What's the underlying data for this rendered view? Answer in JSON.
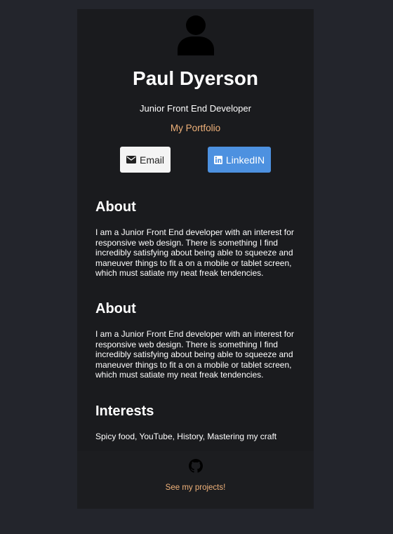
{
  "profile": {
    "name": "Paul Dyerson",
    "role": "Junior Front End Developer",
    "portfolio_label": "My Portfolio"
  },
  "buttons": {
    "email_label": "Email",
    "linkedin_label": "LinkedIN"
  },
  "sections": [
    {
      "title": "About",
      "text": "I am a Junior Front End developer with an interest for responsive web design. There is something I find incredibly satisfying about being able to squeeze and maneuver things to fit a on a mobile or tablet screen, which must satiate my neat freak tendencies."
    },
    {
      "title": "About",
      "text": "I am a Junior Front End developer with an interest for responsive web design. There is something I find incredibly satisfying about being able to squeeze and maneuver things to fit a on a mobile or tablet screen, which must satiate my neat freak tendencies."
    },
    {
      "title": "Interests",
      "text": "Spicy food, YouTube, History, Mastering my craft"
    }
  ],
  "footer": {
    "projects_label": "See my projects!"
  },
  "icons": {
    "avatar": "user-icon",
    "email": "envelope-icon",
    "linkedin": "linkedin-icon",
    "github": "github-icon"
  },
  "colors": {
    "page_bg": "#23252c",
    "card_bg": "#1a1b1e",
    "accent_link": "#f0b27a",
    "linkedin_button": "#4d91e0",
    "email_button": "#f4f4f4"
  }
}
